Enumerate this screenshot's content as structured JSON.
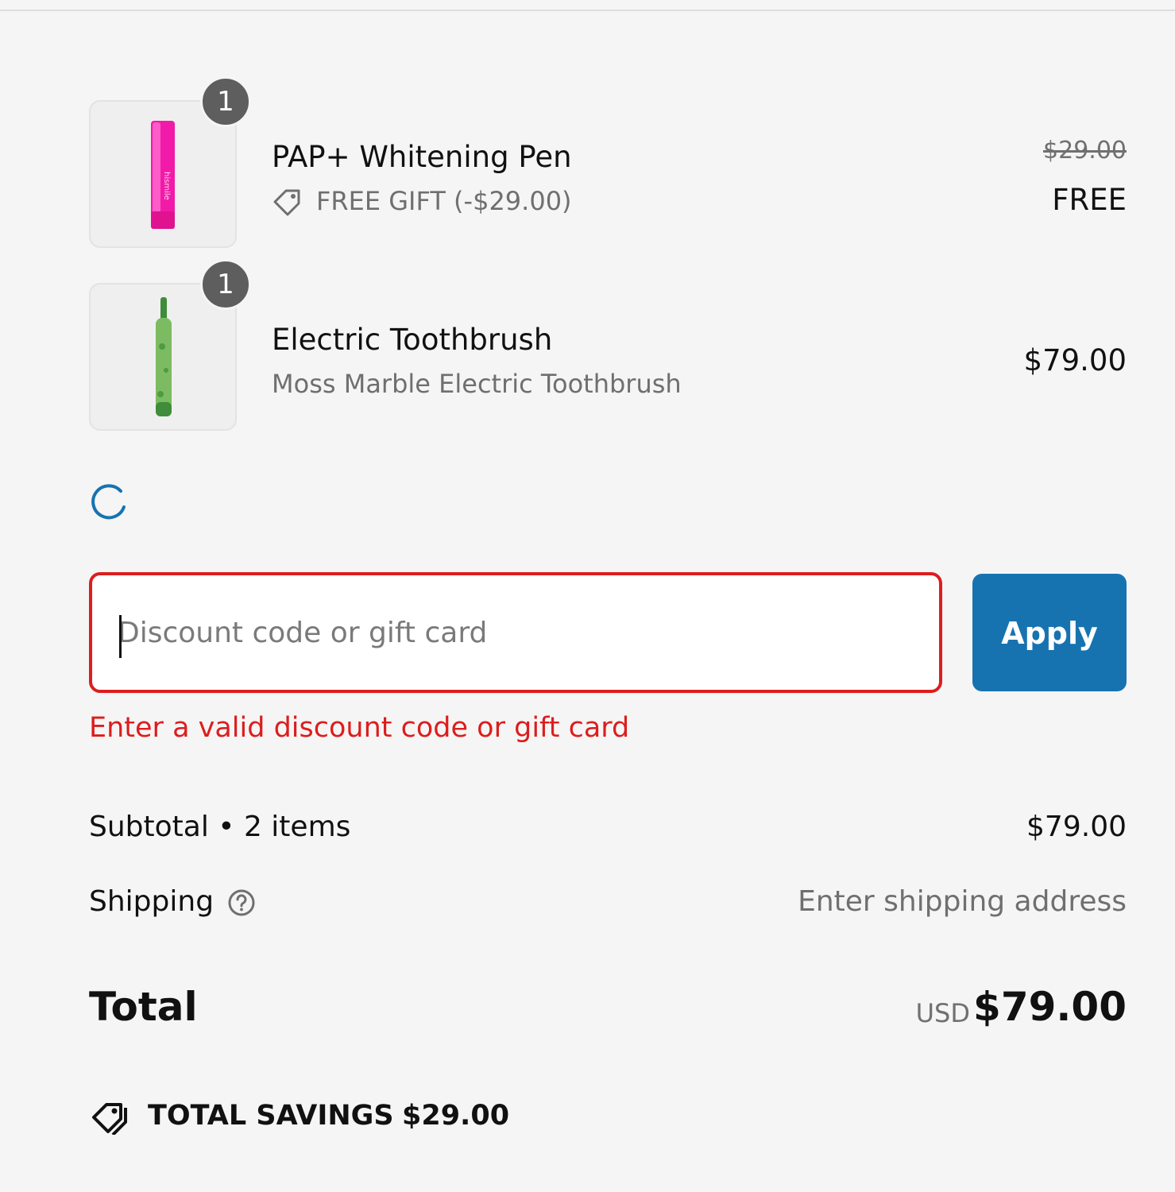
{
  "line_items": [
    {
      "quantity": "1",
      "name": "PAP+ Whitening Pen",
      "discount_label": "FREE GIFT (-$29.00)",
      "original_price": "$29.00",
      "price": "FREE",
      "image_icon": "whitening-pen-image"
    },
    {
      "quantity": "1",
      "name": "Electric Toothbrush",
      "variant": "Moss Marble Electric Toothbrush",
      "price": "$79.00",
      "image_icon": "toothbrush-image"
    }
  ],
  "discount": {
    "placeholder": "Discount code or gift card",
    "value": "",
    "apply_label": "Apply",
    "error": "Enter a valid discount code or gift card"
  },
  "summary": {
    "subtotal_label": "Subtotal • 2 items",
    "subtotal_value": "$79.00",
    "shipping_label": "Shipping",
    "shipping_value": "Enter shipping address",
    "total_label": "Total",
    "currency": "USD",
    "total_value": "$79.00",
    "savings_label": "TOTAL SAVINGS",
    "savings_value": "$29.00"
  },
  "colors": {
    "background": "#f5f5f5",
    "accent": "#1773b0",
    "error": "#dd1d1d"
  }
}
